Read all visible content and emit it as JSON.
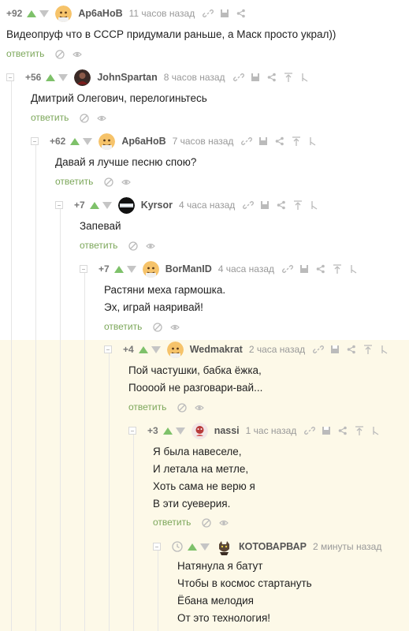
{
  "comments": [
    {
      "rating": "+92",
      "user": "Ар6аНоВ",
      "time": "11 часов назад",
      "lines": [
        "Видеопруф что в СССР придумали раньше, а Маск просто украл))"
      ],
      "reply": "ответить"
    },
    {
      "rating": "+56",
      "user": "JohnSpartan",
      "time": "8 часов назад",
      "lines": [
        "Дмитрий Олегович, перелогиньтесь"
      ],
      "reply": "ответить"
    },
    {
      "rating": "+62",
      "user": "Ар6аНоВ",
      "time": "7 часов назад",
      "lines": [
        "Давай я лучше песню спою?"
      ],
      "reply": "ответить"
    },
    {
      "rating": "+7",
      "user": "Kyrsor",
      "time": "4 часа назад",
      "lines": [
        "Запевай"
      ],
      "reply": "ответить"
    },
    {
      "rating": "+7",
      "user": "BorManID",
      "time": "4 часа назад",
      "lines": [
        "Растяни меха гармошка.",
        "Эх, играй наяривай!"
      ],
      "reply": "ответить"
    },
    {
      "rating": "+4",
      "user": "Wedmakrat",
      "time": "2 часа назад",
      "lines": [
        "Пой частушки, бабка ёжка,",
        "Поооой не разговари-вай..."
      ],
      "reply": "ответить"
    },
    {
      "rating": "+3",
      "user": "nassi",
      "time": "1 час назад",
      "lines": [
        "Я была навеселе,",
        "И летала на метле,",
        "Хоть сама не верю я",
        "В эти суеверия."
      ],
      "reply": "ответить"
    },
    {
      "rating": "",
      "user": "КОТОВАРВАР",
      "time": "2 минуты назад",
      "lines": [
        "Натянула я батут",
        "Чтобы в космос стартануть",
        "Ёбана мелодия",
        "От это технология!"
      ],
      "reply": ""
    }
  ],
  "colors": {
    "accent_green": "#7ec16a",
    "reply_green": "#7ca75a",
    "new_highlight": "#fdf9e8"
  },
  "icons": [
    "link-icon",
    "save-icon",
    "share-icon",
    "go-to-parent-icon",
    "go-to-root-icon",
    "hide-icon",
    "show-icon",
    "clock-icon"
  ]
}
